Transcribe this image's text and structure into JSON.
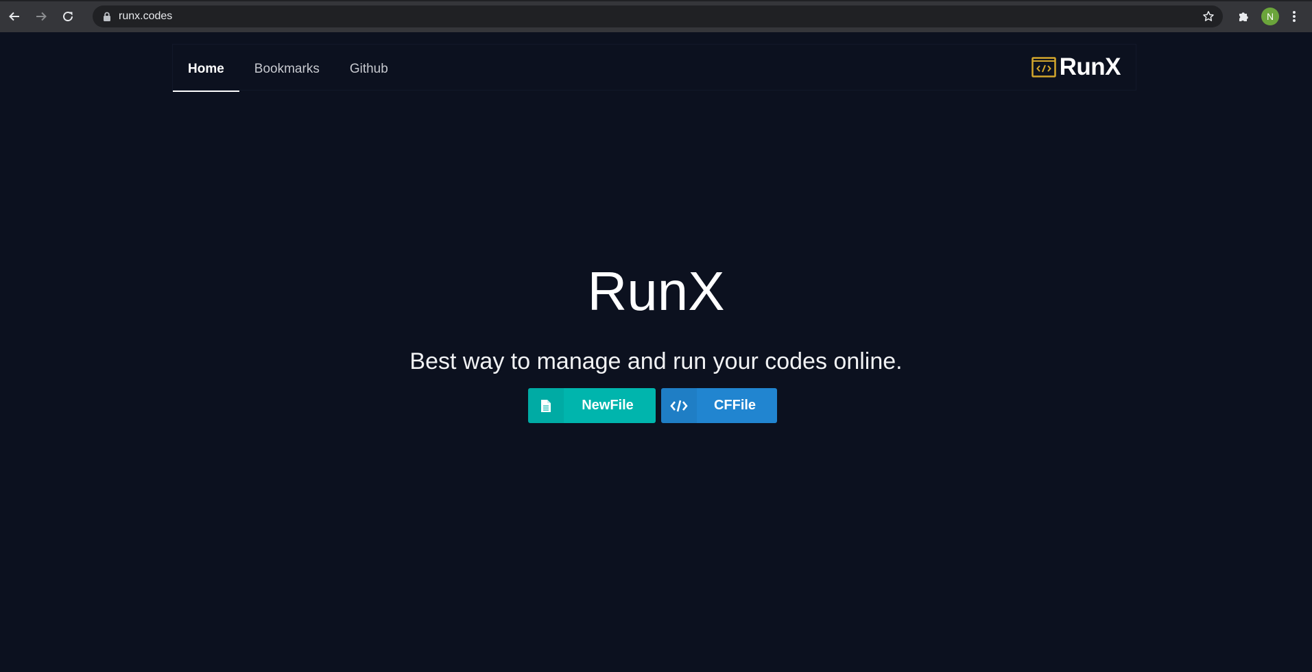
{
  "browser": {
    "url": "runx.codes",
    "profile_initial": "N"
  },
  "nav": {
    "tabs": [
      {
        "label": "Home",
        "active": true
      },
      {
        "label": "Bookmarks",
        "active": false
      },
      {
        "label": "Github",
        "active": false
      }
    ],
    "brand_text": "RunX"
  },
  "hero": {
    "title": "RunX",
    "subtitle": "Best way to manage and run your codes online.",
    "buttons": {
      "new_file_label": "NewFile",
      "cf_file_label": "CFFile"
    }
  },
  "colors": {
    "background": "#0c111f",
    "new_file_button": "#00b5ad",
    "cf_file_button": "#2185d0",
    "brand_icon": "#d4a72c"
  },
  "icons": {
    "new_file_button": "file-icon",
    "cf_file_button": "code-icon",
    "brand": "code-window-icon"
  }
}
